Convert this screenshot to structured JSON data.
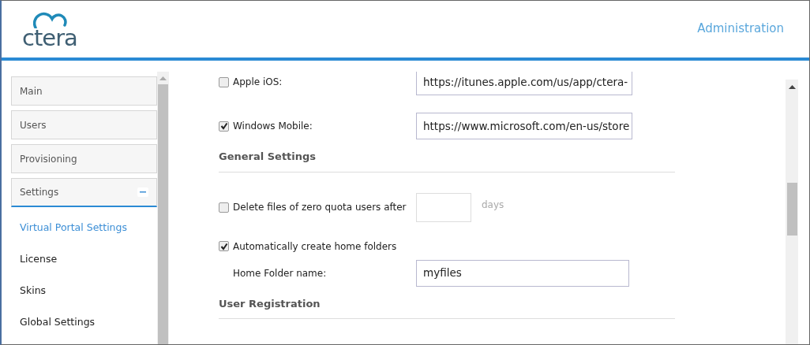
{
  "header": {
    "logo": "ctera",
    "title": "Administration"
  },
  "sidebar": {
    "items": [
      {
        "label": "Main",
        "expanded": false
      },
      {
        "label": "Users",
        "expanded": false
      },
      {
        "label": "Provisioning",
        "expanded": false
      },
      {
        "label": "Settings",
        "expanded": true,
        "children": [
          {
            "label": "Virtual Portal Settings",
            "selected": true
          },
          {
            "label": "License",
            "selected": false
          },
          {
            "label": "Skins",
            "selected": false
          },
          {
            "label": "Global Settings",
            "selected": false
          }
        ]
      }
    ]
  },
  "form": [
    {
      "kind": "checkbox-url",
      "label": "Apple iOS:",
      "checked": false,
      "value": "https://itunes.apple.com/us/app/ctera-"
    },
    {
      "kind": "checkbox-url",
      "label": "Windows Mobile:",
      "checked": true,
      "value": "https://www.microsoft.com/en-us/store"
    },
    {
      "kind": "heading",
      "label": "General Settings"
    },
    {
      "kind": "checkbox-number",
      "label": "Delete files of zero quota users after",
      "checked": false,
      "unit": "days"
    },
    {
      "kind": "checkbox",
      "label": "Automatically create home folders",
      "checked": true
    },
    {
      "kind": "text-field",
      "label": "Home Folder name:",
      "value": "myfiles"
    },
    {
      "kind": "heading",
      "label": "User Registration"
    }
  ]
}
